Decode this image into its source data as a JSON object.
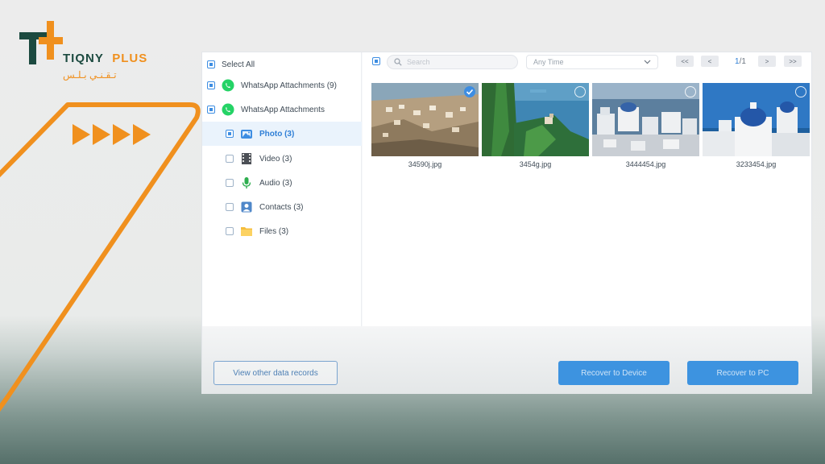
{
  "brand": {
    "name_main": "TIQNY",
    "name_accent": "PLUS",
    "arabic": "تـقـنـي بـلـس"
  },
  "colors": {
    "accent_orange": "#f0901e",
    "brand_green": "#1c4a40",
    "primary_blue": "#3d93e0"
  },
  "sidebar": {
    "select_all": {
      "label": "Select All",
      "checked": true
    },
    "items": [
      {
        "label": "WhatsApp Attachments (9)",
        "icon": "whatsapp-icon",
        "checked": true
      },
      {
        "label": "WhatsApp Attachments",
        "icon": "whatsapp-icon",
        "checked": true
      },
      {
        "label": "Photo (3)",
        "icon": "photo-icon",
        "checked": true,
        "active": true
      },
      {
        "label": "Video (3)",
        "icon": "video-icon",
        "checked": false
      },
      {
        "label": "Audio (3)",
        "icon": "microphone-icon",
        "checked": false
      },
      {
        "label": "Contacts (3)",
        "icon": "contacts-icon",
        "checked": false
      },
      {
        "label": "Files (3)",
        "icon": "folder-icon",
        "checked": false
      }
    ]
  },
  "toolbar": {
    "search_placeholder": "Search",
    "time_filter": "Any Time",
    "pagination": {
      "first": "<<",
      "prev": "<",
      "current": "1",
      "total": "/1",
      "next": ">",
      "last": ">>"
    }
  },
  "photos": [
    {
      "name": "34590j.jpg",
      "selected": true
    },
    {
      "name": "3454g.jpg",
      "selected": false
    },
    {
      "name": "3444454.jpg",
      "selected": false
    },
    {
      "name": "3233454.jpg",
      "selected": false
    }
  ],
  "footer": {
    "view_other": "View other data records",
    "recover_device": "Recover to Device",
    "recover_pc": "Recover to PC"
  }
}
